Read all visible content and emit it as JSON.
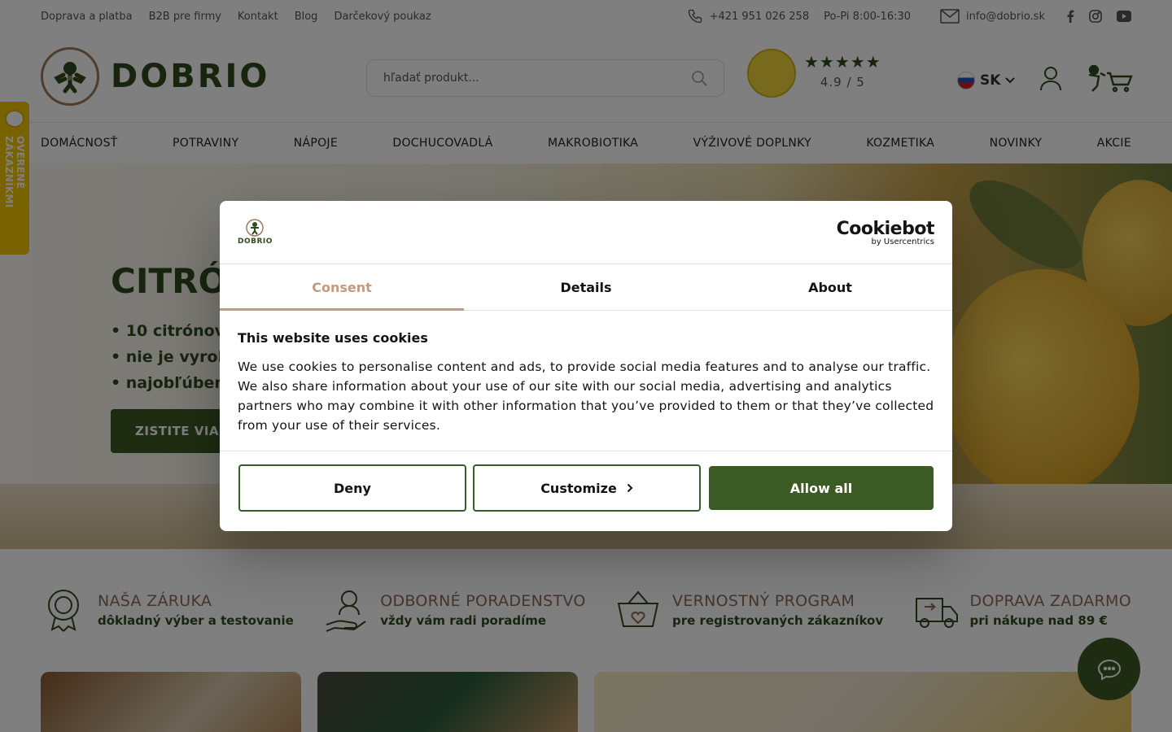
{
  "topbar": {
    "links": [
      "Doprava a platba",
      "B2B pre firmy",
      "Kontakt",
      "Blog",
      "Darčekový poukaz"
    ],
    "phone": "+421 951 026 258",
    "hours": "Po-Pi 8:00-16:30",
    "email": "info@dobrio.sk"
  },
  "header": {
    "logo_text": "DOBRIO",
    "search_placeholder": "hľadať produkt...",
    "rating_stars": "★★★★★",
    "rating_score": "4.9 / 5",
    "language": "SK"
  },
  "nav": [
    "DOMÁCNOSŤ",
    "POTRAVINY",
    "NÁPOJE",
    "DOCHUCOVADLÁ",
    "MAKROBIOTIKA",
    "VÝŽIVOVÉ DOPLNKY",
    "KOZMETIKA",
    "NOVINKY",
    "AKCIE"
  ],
  "hero": {
    "title": "CITRÓN",
    "bullets": [
      "• 10 citrónov z",
      "• nie je vyrobe",
      "• najobľúbene"
    ],
    "button": "ZISTITE VIAC"
  },
  "benefits": [
    {
      "title": "NAŠA ZÁRUKA",
      "subtitle": "dôkladný výber a testovanie"
    },
    {
      "title": "ODBORNÉ PORADENSTVO",
      "subtitle": "vždy vám radi poradíme"
    },
    {
      "title": "VERNOSTNÝ PROGRAM",
      "subtitle": "pre registrovaných zákazníkov"
    },
    {
      "title": "DOPRAVA ZADARMO",
      "subtitle": "pri nákupe nad 89 €"
    }
  ],
  "ribbon": {
    "text": "OVERENÉ ZÁKAZNÍKMI"
  },
  "cookie": {
    "brand_logo_text": "DOBRIO",
    "provider": "Cookiebot",
    "provider_sub": "by Usercentrics",
    "tabs": [
      "Consent",
      "Details",
      "About"
    ],
    "heading": "This website uses cookies",
    "body": "We use cookies to personalise content and ads, to provide social media features and to analyse our traffic. We also share information about your use of our site with our social media, advertising and analytics partners who may combine it with other information that you’ve provided to them or that they’ve collected from your use of their services.",
    "buttons": {
      "deny": "Deny",
      "customize": "Customize",
      "allow": "Allow all"
    }
  },
  "colors": {
    "brand_green": "#3c5a24",
    "accent_tan": "#c49a7a",
    "ribbon_yellow": "#f3c700"
  }
}
